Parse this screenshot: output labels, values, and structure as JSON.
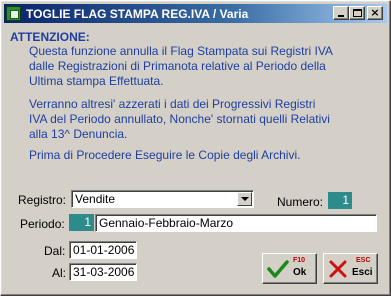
{
  "window": {
    "title": "TOGLIE FLAG STAMPA REG.IVA / Varia"
  },
  "titlebar_buttons": {
    "minimize": "_",
    "maximize": "□",
    "close": "×"
  },
  "notice": {
    "heading": "ATTENZIONE:",
    "paragraph1": "Questa funzione annulla il Flag Stampata sui Registri IVA\ndalle Registrazioni di Primanota relative al Periodo della\nUltima stampa Effettuata.",
    "paragraph2": "Verranno altresi' azzerati i dati dei Progressivi Registri\nIVA del Periodo annullato, Nonche' stornati quelli Relativi\nalla 13^ Denuncia.",
    "paragraph3": "Prima di Procedere Eseguire le Copie degli Archivi."
  },
  "form": {
    "registro_label": "Registro:",
    "registro_value": "Vendite",
    "numero_label": "Numero:",
    "numero_value": "1",
    "periodo_label": "Periodo:",
    "periodo_number": "1",
    "periodo_desc": "Gennaio-Febbraio-Marzo",
    "dal_label": "Dal:",
    "dal_value": "01-01-2006",
    "al_label": "Al:",
    "al_value": "31-03-2006"
  },
  "buttons": {
    "ok_key": "F10",
    "ok_label": "Ok",
    "esc_key": "ESC",
    "esc_label": "Esci"
  },
  "colors": {
    "accent_text": "#1f3fa0",
    "field_highlight": "#2e8b8b",
    "titlebar": "#0a246a"
  },
  "icons": {
    "ok": "green-checkmark-icon",
    "esc": "red-x-icon",
    "app": "app-icon"
  }
}
